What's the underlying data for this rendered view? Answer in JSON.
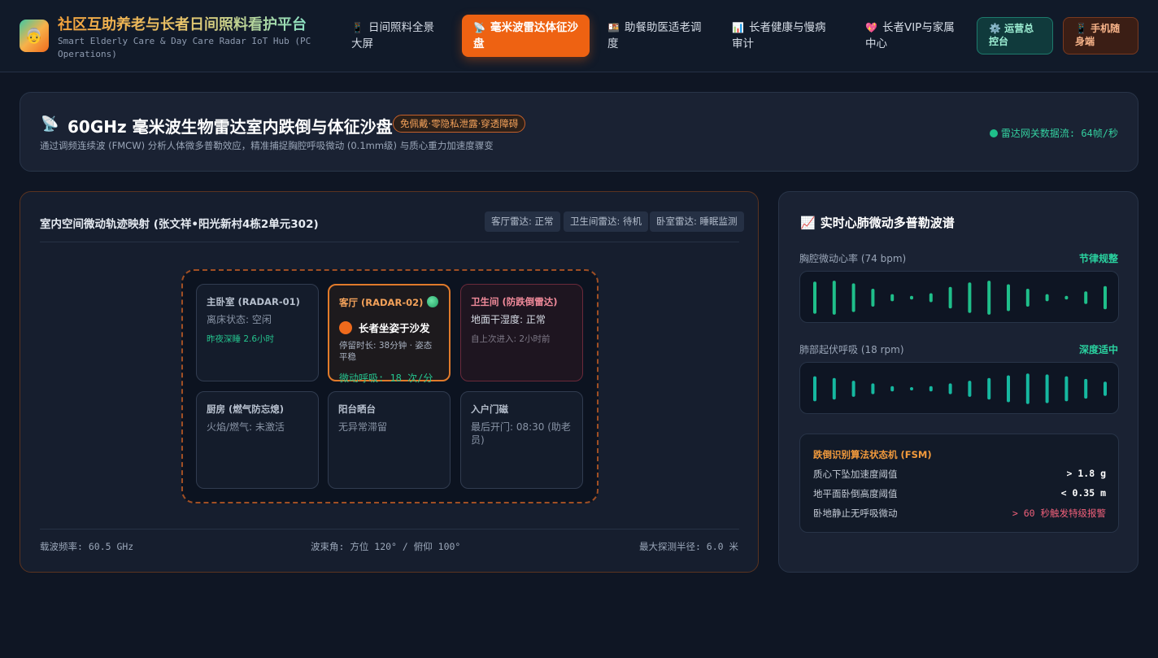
{
  "header": {
    "logo_emoji": "👵",
    "title": "社区互助养老与长者日间照料看护平台",
    "subtitle": "Smart Elderly Care & Day Care Radar IoT Hub (PC Operations)",
    "nav": [
      {
        "icon": "📱",
        "label": "日间照料全景大屏",
        "active": false
      },
      {
        "icon": "📡",
        "label": "毫米波雷达体征沙盘",
        "active": true
      },
      {
        "icon": "🍱",
        "label": "助餐助医适老调度",
        "active": false
      },
      {
        "icon": "📊",
        "label": "长者健康与慢病审计",
        "active": false
      },
      {
        "icon": "💖",
        "label": "长者VIP与家属中心",
        "active": false
      }
    ],
    "ops_button": {
      "icon": "⚙️",
      "label": "运营总控台"
    },
    "mobile_button": {
      "icon": "📱",
      "label": "手机随身端"
    }
  },
  "banner": {
    "icon": "📡",
    "title": "60GHz 毫米波生物雷达室内跌倒与体征沙盘",
    "tag": "免佩戴·零隐私泄露·穿透障碍",
    "description": "通过调频连续波 (FMCW) 分析人体微多普勒效应，精准捕捉胸腔呼吸微动 (0.1mm级) 与质心重力加速度骤变",
    "stream": "雷达网关数据流: 64帧/秒",
    "stream_color": "#1fbf8a"
  },
  "map": {
    "title": "室内空间微动轨迹映射 (张文祥•阳光新村4栋2单元302)",
    "radar_status": [
      "客厅雷达: 正常",
      "卫生间雷达: 待机",
      "卧室雷达: 睡眠监测"
    ],
    "rooms": [
      {
        "name": "主卧室 (RADAR-01)",
        "state": "离床状态: 空闲",
        "note": "昨夜深睡 2.6小时"
      },
      {
        "name": "客厅 (RADAR-02)",
        "person": "长者坐姿于沙发",
        "detail": "停留时长: 38分钟 · 姿态平稳",
        "breath": "微动呼吸: 18 次/分"
      },
      {
        "name": "卫生间 (防跌倒雷达)",
        "state": "地面干湿度: 正常",
        "note": "自上次进入: 2小时前"
      },
      {
        "name": "厨房 (燃气防忘熄)",
        "state": "火焰/燃气: 未激活"
      },
      {
        "name": "阳台晒台",
        "state": "无异常滞留"
      },
      {
        "name": "入户门磁",
        "state": "最后开门: 08:30 (助老员)"
      }
    ],
    "footer": {
      "frequency": "载波频率: 60.5 GHz",
      "beam": "波束角: 方位 120° / 俯仰 100°",
      "radius": "最大探测半径: 6.0 米"
    }
  },
  "spectrum": {
    "icon": "📈",
    "title": "实时心肺微动多普勒波谱",
    "heart": {
      "label": "胸腔微动心率 (74 bpm)",
      "status": "节律规整",
      "amplitudes": [
        0.9,
        0.95,
        0.8,
        0.5,
        0.2,
        0.1,
        0.25,
        0.6,
        0.85,
        0.95,
        0.75,
        0.5,
        0.2,
        0.1,
        0.35,
        0.65
      ],
      "color": "#1fbf8a"
    },
    "breath": {
      "label": "肺部起伏呼吸 (18 rpm)",
      "status": "深度适中",
      "amplitudes": [
        0.7,
        0.6,
        0.45,
        0.3,
        0.15,
        0.05,
        0.15,
        0.3,
        0.45,
        0.6,
        0.75,
        0.85,
        0.8,
        0.7,
        0.55,
        0.4
      ],
      "color": "#16b8a0"
    },
    "fsm": {
      "title": "跌倒识别算法状态机 (FSM)",
      "rows": [
        {
          "label": "质心下坠加速度阈值",
          "value": "> 1.8 g"
        },
        {
          "label": "地平面卧倒高度阈值",
          "value": "< 0.35 m"
        },
        {
          "label": "卧地静止无呼吸微动",
          "value": "> 60 秒触发特级报警"
        }
      ]
    }
  }
}
